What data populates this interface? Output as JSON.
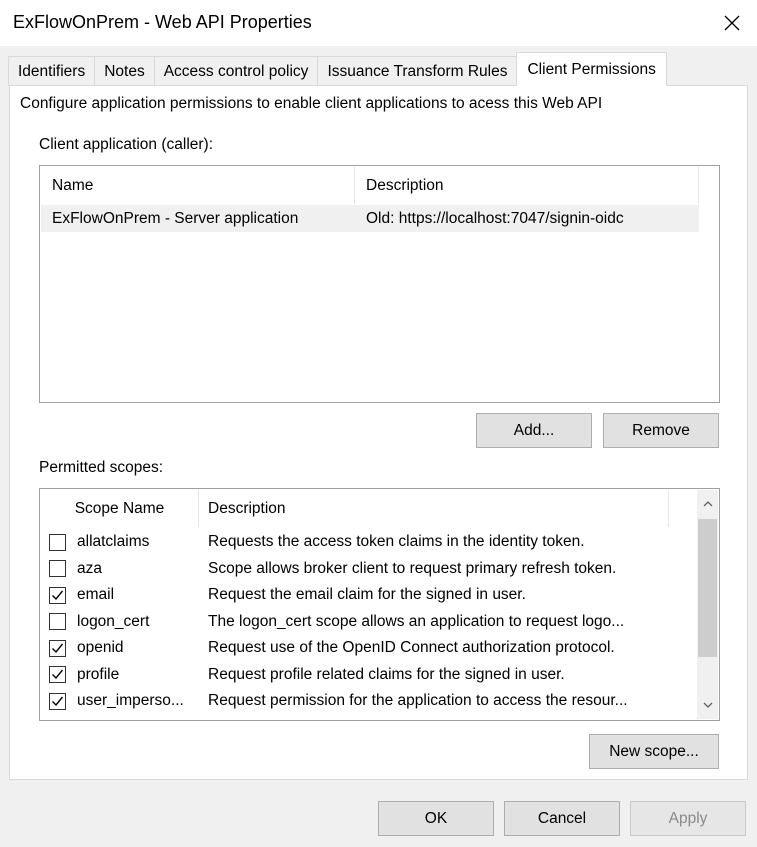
{
  "window": {
    "title": "ExFlowOnPrem - Web API Properties",
    "close_icon": "close-icon"
  },
  "tabs": [
    {
      "label": "Identifiers",
      "active": false
    },
    {
      "label": "Notes",
      "active": false
    },
    {
      "label": "Access control policy",
      "active": false
    },
    {
      "label": "Issuance Transform Rules",
      "active": false
    },
    {
      "label": "Client Permissions",
      "active": true
    }
  ],
  "panel": {
    "description": "Configure application permissions to enable client applications to acess this Web API",
    "client_label": "Client application (caller):",
    "client_columns": [
      "Name",
      "Description"
    ],
    "clients": [
      {
        "name": "ExFlowOnPrem - Server application",
        "description": "Old: https://localhost:7047/signin-oidc"
      }
    ],
    "add_label": "Add...",
    "remove_label": "Remove",
    "scopes_label": "Permitted scopes:",
    "scope_columns": [
      "Scope Name",
      "Description"
    ],
    "scopes": [
      {
        "name": "allatclaims",
        "description": "Requests the access token claims in the identity token.",
        "checked": false
      },
      {
        "name": "aza",
        "description": "Scope allows broker client to request primary refresh token.",
        "checked": false
      },
      {
        "name": "email",
        "description": "Request the email claim for the signed in user.",
        "checked": true
      },
      {
        "name": "logon_cert",
        "description": "The logon_cert scope allows an application to request logo...",
        "checked": false
      },
      {
        "name": "openid",
        "description": "Request use of the OpenID Connect authorization protocol.",
        "checked": true
      },
      {
        "name": "profile",
        "description": "Request profile related claims for the signed in user.",
        "checked": true
      },
      {
        "name": "user_imperso...",
        "description": "Request permission for the application to access the resour...",
        "checked": true
      }
    ],
    "new_scope_label": "New scope..."
  },
  "footer": {
    "ok_label": "OK",
    "cancel_label": "Cancel",
    "apply_label": "Apply",
    "apply_enabled": false
  },
  "colors": {
    "dialog_bg": "#f0f0f0",
    "selected_row": "#f0f0f0",
    "button_bg": "#e1e1e1",
    "button_border": "#adadad"
  }
}
